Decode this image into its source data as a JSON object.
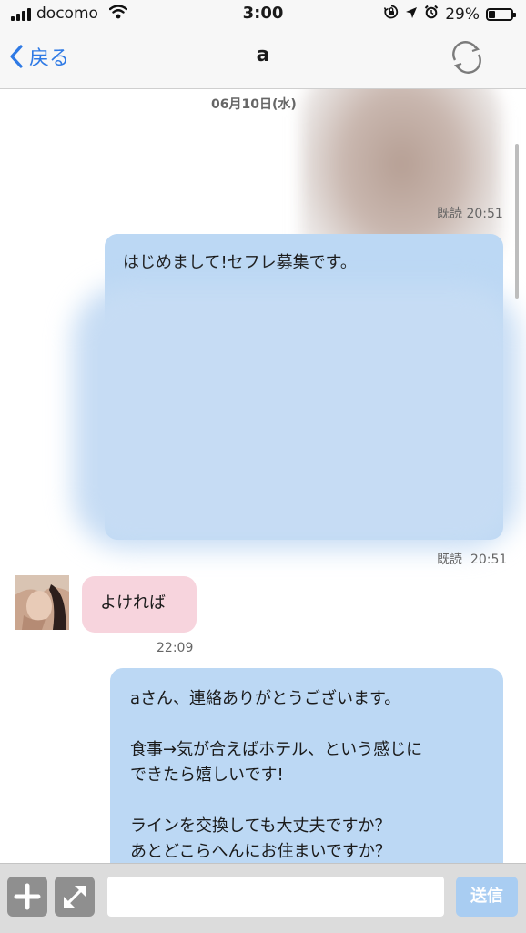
{
  "status_bar": {
    "carrier": "docomo",
    "time": "3:00",
    "battery": "29%",
    "battery_level": 0.29
  },
  "nav": {
    "back_label": "戻る",
    "title": "a"
  },
  "chat": {
    "date_separator": "06月10日(水)",
    "photo_read": "既読",
    "photo_time": "20:51",
    "msg1_text": "はじめまして!セフレ募集です。",
    "msg1_read": "既読",
    "msg1_time": "20:51",
    "incoming_text": "よければ",
    "incoming_time": "22:09",
    "msg2_lines": [
      "aさん、連絡ありがとうございます。",
      "",
      "食事→気が合えばホテル、という感じに",
      "できたら嬉しいです!",
      "",
      "ラインを交換しても大丈夫ですか？",
      "あとどこらへんにお住まいですか？"
    ]
  },
  "input_bar": {
    "message_value": "",
    "send_label": "送信"
  },
  "colors": {
    "accent": "#2f7ae5",
    "outgoing_bubble": "#bcd8f4",
    "incoming_bubble": "#f7d4dd",
    "send_button": "#a9cdf2"
  },
  "icons": {
    "back": "chevron-left-icon",
    "refresh": "refresh-icon",
    "add": "plus-icon",
    "expand": "expand-arrows-icon",
    "signal": "cellular-signal-icon",
    "wifi": "wifi-icon",
    "lock": "orientation-lock-icon",
    "location": "location-arrow-icon",
    "alarm": "alarm-icon",
    "battery": "battery-icon"
  }
}
